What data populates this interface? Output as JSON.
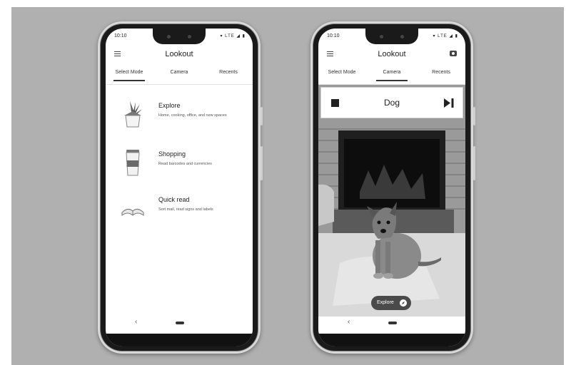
{
  "status": {
    "time": "10:10",
    "icons": "▾ LTE ◢ ▮"
  },
  "app": {
    "title": "Lookout"
  },
  "tabs": [
    "Select Mode",
    "Camera",
    "Recents"
  ],
  "modes": [
    {
      "name": "Explore",
      "description": "Home, cooking, office, and new spaces",
      "icon": "plant-icon"
    },
    {
      "name": "Shopping",
      "description": "Read barcodes and currencies",
      "icon": "coffee-cup-icon"
    },
    {
      "name": "Quick read",
      "description": "Sort mail, read signs and labels",
      "icon": "book-icon"
    }
  ],
  "camera": {
    "detected_label": "Dog",
    "chip_label": "Explore"
  },
  "nav": {
    "back_glyph": "‹"
  },
  "icons": {
    "menu": "menu-icon",
    "camera": "camera-icon",
    "stop": "stop-icon",
    "skip": "skip-next-icon",
    "compass": "compass-icon"
  }
}
